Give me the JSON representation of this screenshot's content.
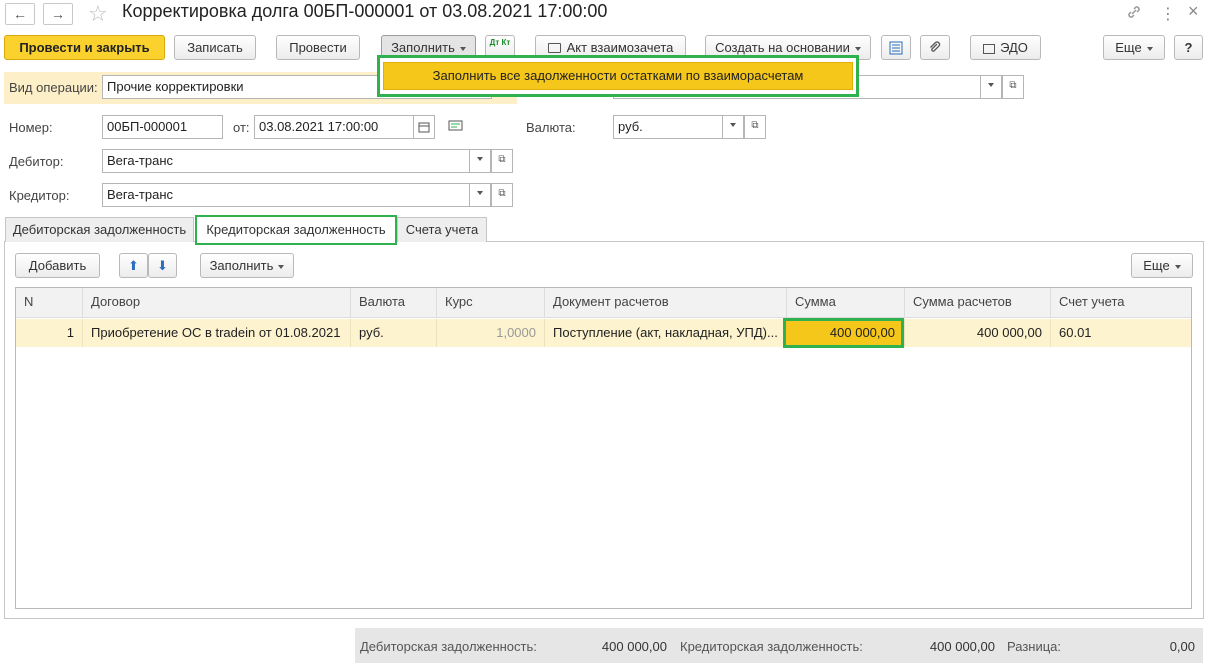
{
  "window": {
    "title": "Корректировка долга 00БП-000001 от 03.08.2021 17:00:00",
    "back_icon": "←",
    "forward_icon": "→",
    "star_icon": "☆",
    "link_icon": "🔗",
    "more_icon": "⋮",
    "close_icon": "×"
  },
  "toolbar": {
    "post_close": "Провести и закрыть",
    "save": "Записать",
    "post": "Провести",
    "fill": "Заполнить",
    "dtkt": "Дт Кт",
    "act": "Акт взаимозачета",
    "create_based": "Создать на основании",
    "edo": "ЭДО",
    "more": "Еще",
    "help": "?"
  },
  "fill_menu": {
    "item": "Заполнить все задолженности остатками по взаиморасчетам"
  },
  "form": {
    "operation_label": "Вид операции:",
    "operation_value": "Прочие корректировки",
    "number_label": "Номер:",
    "number_value": "00БП-000001",
    "date_label": "от:",
    "date_value": "03.08.2021 17:00:00",
    "currency_label": "Валюта:",
    "currency_value": "руб.",
    "debtor_label": "Дебитор:",
    "debtor_value": "Вега-транс",
    "creditor_label": "Кредитор:",
    "creditor_value": "Вега-транс"
  },
  "tabs": [
    {
      "label": "Дебиторская задолженность"
    },
    {
      "label": "Кредиторская задолженность"
    },
    {
      "label": "Счета учета"
    }
  ],
  "table_toolbar": {
    "add": "Добавить",
    "up": "⬆",
    "down": "⬇",
    "fill": "Заполнить",
    "more": "Еще"
  },
  "table": {
    "headers": [
      "N",
      "Договор",
      "Валюта",
      "Курс",
      "Документ расчетов",
      "Сумма",
      "Сумма расчетов",
      "Счет учета"
    ],
    "rows": [
      {
        "n": "1",
        "contract": "Приобретение ОС в tradein от 01.08.2021",
        "currency": "руб.",
        "rate": "1,0000",
        "doc": "Поступление (акт, накладная, УПД)...",
        "sum": "400 000,00",
        "sum_settle": "400 000,00",
        "account": "60.01"
      }
    ]
  },
  "footer": {
    "debit_label": "Дебиторская задолженность:",
    "debit_value": "400 000,00",
    "credit_label": "Кредиторская задолженность:",
    "credit_value": "400 000,00",
    "diff_label": "Разница:",
    "diff_value": "0,00"
  },
  "colors": {
    "accent_yellow": "#fbd22d",
    "highlight_green": "#2fb14f",
    "row_selected": "#fdf3cf"
  }
}
